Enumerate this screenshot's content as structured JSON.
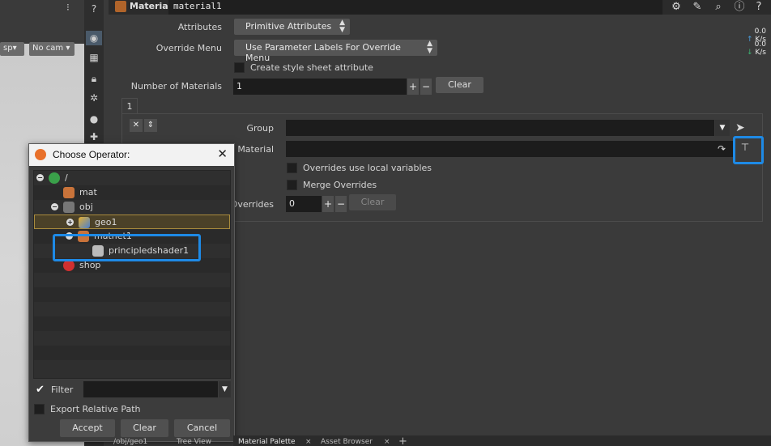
{
  "viewport": {
    "persp_label": "sp",
    "cam_label": "No cam"
  },
  "panel": {
    "node_type": "Material",
    "node_name": "material1",
    "attributes_label": "Attributes",
    "attributes_value": "Primitive Attributes",
    "override_menu_label": "Override Menu",
    "override_menu_value": "Use Parameter Labels For Override Menu",
    "style_sheet_label": "Create style sheet attribute",
    "num_materials_label": "Number of Materials",
    "num_materials_value": "1",
    "clear_label": "Clear",
    "tab_label": "1",
    "group_label": "Group",
    "material_label": "Material",
    "local_vars_label": "Overrides use local variables",
    "merge_overrides_label": "Merge Overrides",
    "overrides_label": "Overrides",
    "overrides_value": "0",
    "overrides_clear_label": "Clear",
    "rate_1_value": "0.0",
    "rate_1_unit": "K/s",
    "rate_2_value": "0.0",
    "rate_2_unit": "K/s"
  },
  "dialog": {
    "title": "Choose Operator:",
    "tree": [
      {
        "label": "/"
      },
      {
        "label": "mat"
      },
      {
        "label": "obj"
      },
      {
        "label": "geo1"
      },
      {
        "label": "matnet1"
      },
      {
        "label": "principledshader1"
      },
      {
        "label": "shop"
      }
    ],
    "filter_label": "Filter",
    "filter_value": "",
    "export_label": "Export Relative Path",
    "accept_label": "Accept",
    "clear_label": "Clear",
    "cancel_label": "Cancel"
  },
  "bottom_tabs": [
    {
      "label": "/obj/geo1"
    },
    {
      "label": "Tree View"
    },
    {
      "label": "Material Palette"
    },
    {
      "label": "Asset Browser"
    }
  ],
  "colors": {
    "highlight": "#1e8ae6",
    "selection": "#a98b3d"
  }
}
